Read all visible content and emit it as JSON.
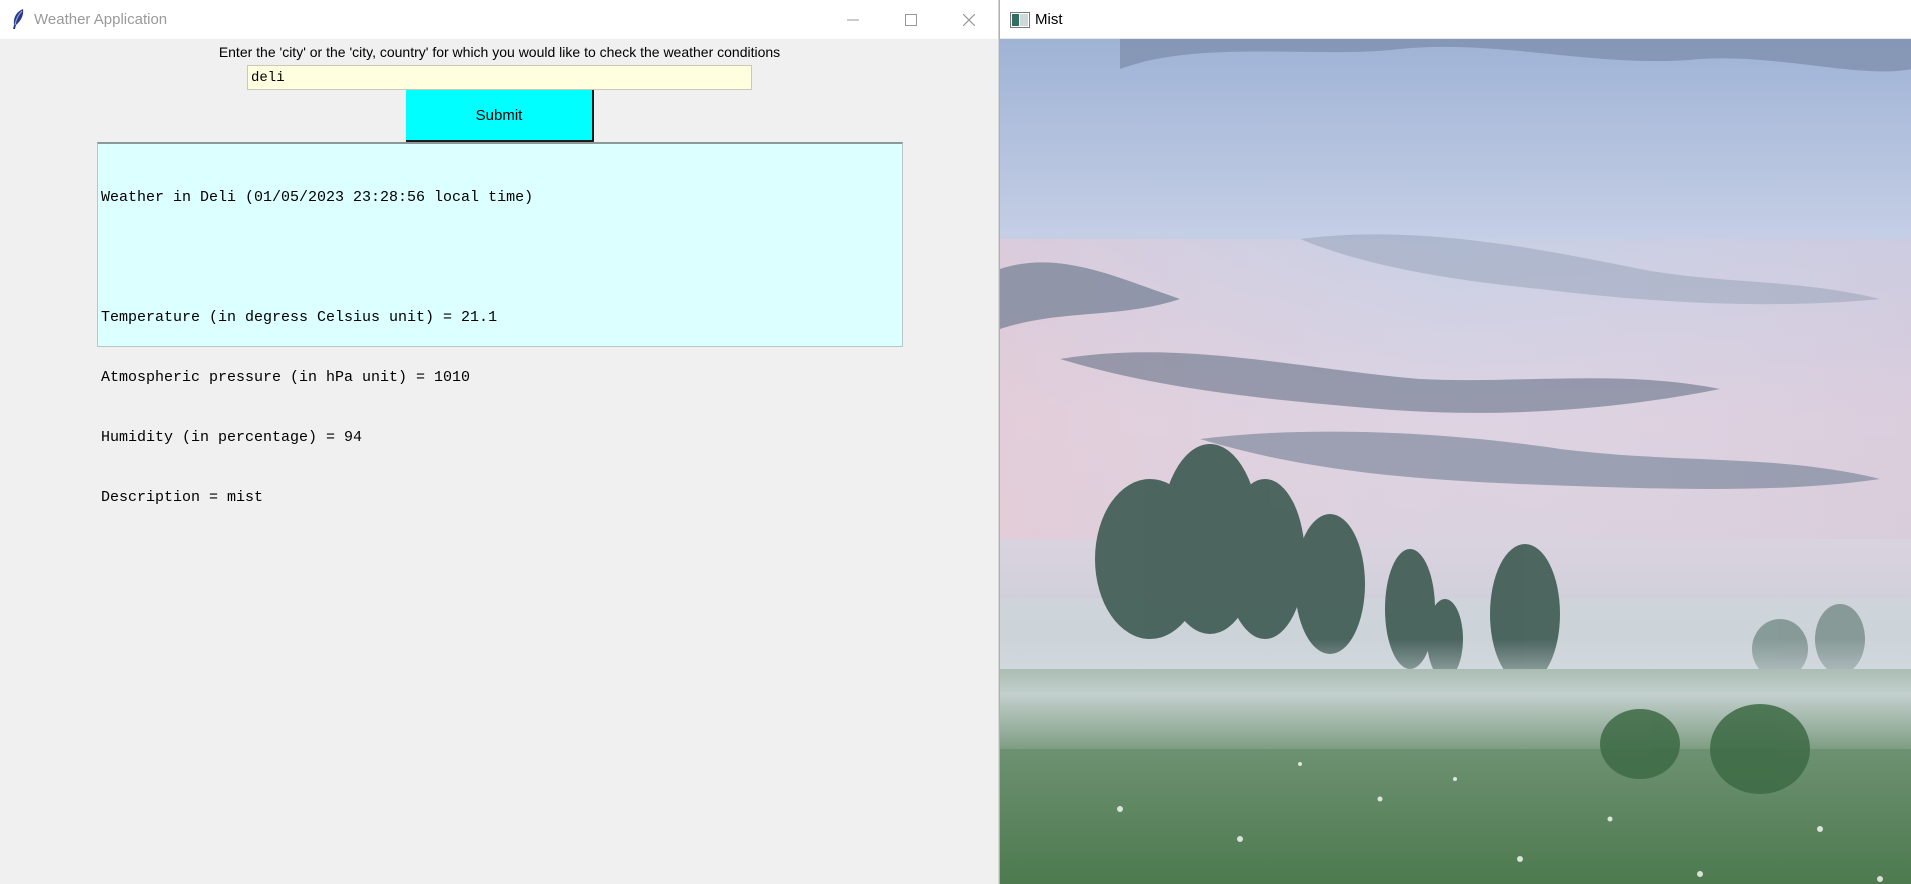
{
  "weather_window": {
    "title": "Weather Application",
    "prompt": "Enter the 'city' or the 'city, country' for which you would like to check the weather conditions",
    "input_value": "deli",
    "submit_label": "Submit",
    "output_lines": [
      "Weather in Deli (01/05/2023 23:28:56 local time)",
      "",
      "Temperature (in degress Celsius unit) = 21.1",
      "Atmospheric pressure (in hPa unit) = 1010",
      "Humidity (in percentage) = 94",
      "Description = mist"
    ],
    "icons": [
      "feather-icon",
      "minimize-icon",
      "maximize-icon",
      "close-icon"
    ]
  },
  "mist_window": {
    "title": "Mist",
    "icons": [
      "window-app-icon"
    ]
  },
  "colors": {
    "input_bg": "#ffffe0",
    "submit_bg": "#00ffff",
    "output_bg": "#dcffff",
    "window_bg": "#f0f0f0"
  }
}
